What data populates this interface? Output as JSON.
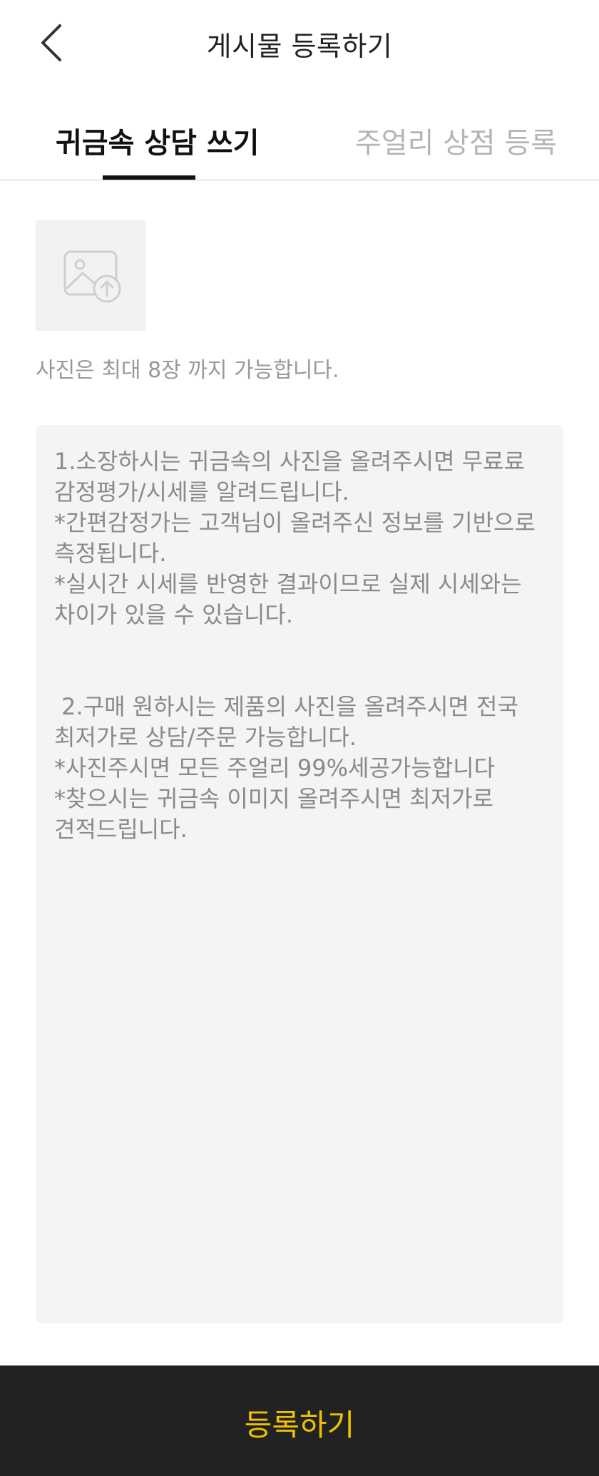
{
  "header": {
    "title": "게시물 등록하기"
  },
  "tabs": [
    {
      "label": "귀금속 상담 쓰기",
      "active": true
    },
    {
      "label": "주얼리 상점 등록",
      "active": false
    }
  ],
  "photo": {
    "icon": "image-upload-icon",
    "hint": "사진은 최대 8장 까지 가능합니다."
  },
  "content": {
    "placeholder": "1.소장하시는 귀금속의 사진을 올려주시면 무료료 감정평가/시세를 알려드립니다.\n*간편감정가는 고객님이 올려주신 정보를 기반으로 측정됩니다.\n*실시간 시세를 반영한 결과이므로 실제 시세와는 차이가 있을 수 있습니다.\n\n\n 2.구매 원하시는 제품의 사진을 올려주시면 전국 최저가로 상담/주문 가능합니다.\n*사진주시면 모든 주얼리 99%세공가능합니다\n*찾으시는 귀금속 이미지 올려주시면 최저가로 견적드립니다."
  },
  "footer": {
    "submit_label": "등록하기"
  },
  "colors": {
    "accent": "#f2c200",
    "bottom_bar": "#222222",
    "inactive_tab": "#b5b5b5"
  }
}
